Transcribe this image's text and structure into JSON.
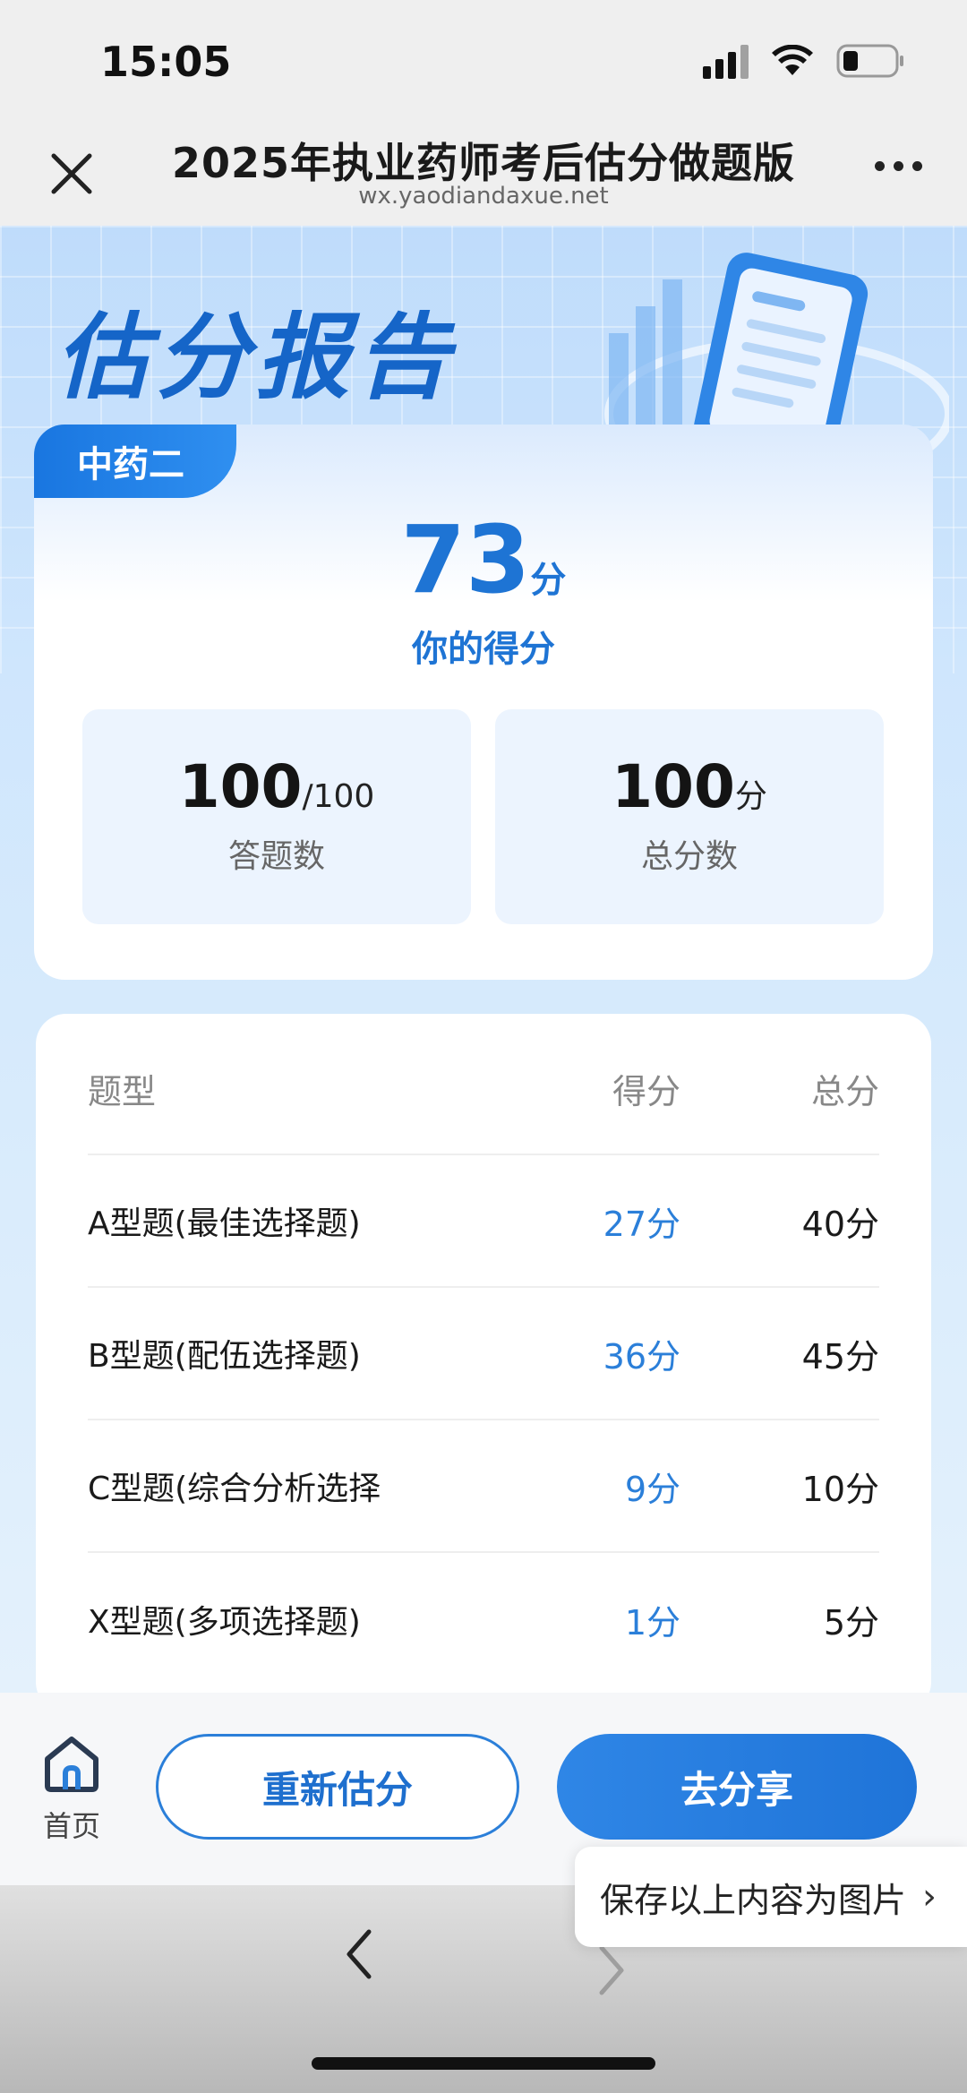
{
  "status": {
    "time": "15:05"
  },
  "nav": {
    "title": "2025年执业药师考后估分做题版",
    "url": "wx.yaodiandaxue.net"
  },
  "banner": {
    "title": "估分报告"
  },
  "score_card": {
    "subject": "中药二",
    "score": "73",
    "score_unit": "分",
    "score_label": "你的得分",
    "answered": {
      "value": "100",
      "suffix": "/100",
      "label": "答题数"
    },
    "total": {
      "value": "100",
      "suffix": "分",
      "label": "总分数"
    }
  },
  "table": {
    "headers": {
      "type": "题型",
      "score": "得分",
      "total": "总分"
    },
    "rows": [
      {
        "type": "A型题(最佳选择题)",
        "score": "27分",
        "total": "40分"
      },
      {
        "type": "B型题(配伍选择题)",
        "score": "36分",
        "total": "45分"
      },
      {
        "type": "C型题(综合分析选择",
        "score": "9分",
        "total": "10分"
      },
      {
        "type": "X型题(多项选择题)",
        "score": "1分",
        "total": "5分"
      }
    ]
  },
  "actions": {
    "home_label": "首页",
    "reestimate_label": "重新估分",
    "share_label": "去分享",
    "save_tip": "保存以上内容为图片"
  },
  "colors": {
    "accent": "#1e74d4",
    "tag": "#1976e0"
  }
}
